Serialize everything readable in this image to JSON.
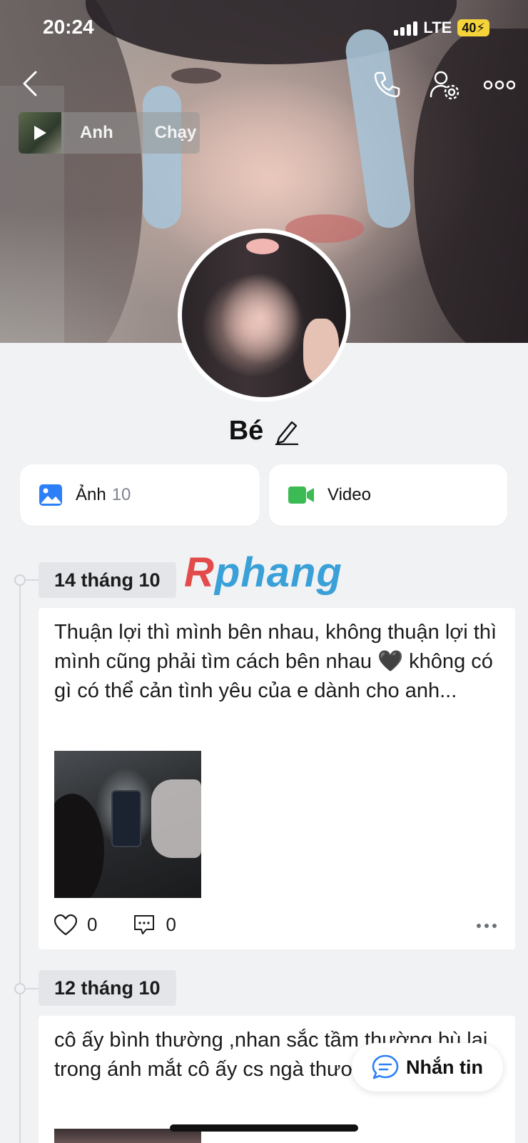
{
  "status_bar": {
    "time": "20:24",
    "network": "LTE",
    "battery": "40"
  },
  "music": {
    "title_part1": "Anh",
    "title_part2": "Chạy"
  },
  "profile": {
    "name": "Bé"
  },
  "media": {
    "photo_label": "Ảnh",
    "photo_count": "10",
    "video_label": "Video"
  },
  "watermark": {
    "part1": "R",
    "part2": "phang"
  },
  "posts": [
    {
      "date": "14 tháng 10",
      "text": "Thuận lợi thì mình bên nhau, không thuận lợi thì mình cũng phải tìm cách bên nhau 🖤 không có gì có thể cản tình yêu của e dành cho anh...",
      "likes": "0",
      "comments": "0"
    },
    {
      "date": "12 tháng 10",
      "text": "cô ấy bình thường ,nhan sắc tầm thường bù lại trong ánh mắt cô ấy cs ngà thương"
    }
  ],
  "message_button": {
    "label": "Nhắn tin"
  },
  "colors": {
    "background": "#f1f2f4",
    "photo_icon": "#2d7ff9",
    "video_icon": "#3cba54",
    "battery": "#f5d33b"
  }
}
